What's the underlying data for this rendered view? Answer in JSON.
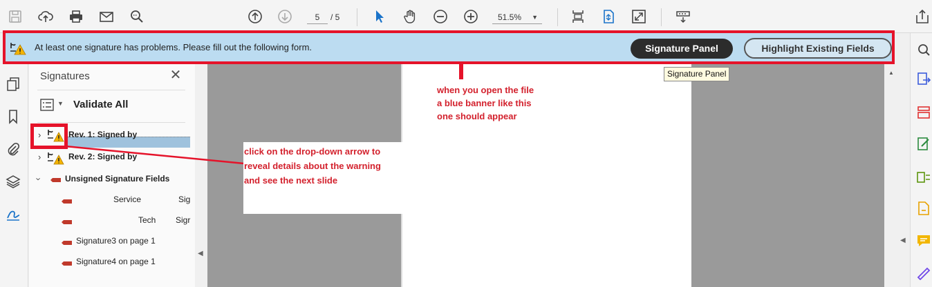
{
  "toolbar": {
    "page_current": "5",
    "page_total": "/ 5",
    "zoom": "51.5%",
    "icons": [
      "save-icon",
      "cloud-upload-icon",
      "print-icon",
      "email-icon",
      "search-icon",
      "arrow-up-icon",
      "arrow-down-icon",
      "select-cursor-icon",
      "hand-icon",
      "zoom-out-icon",
      "zoom-in-icon",
      "fit-page-icon",
      "scroll-mode-icon",
      "fullscreen-icon",
      "stamp-icon",
      "share-icon"
    ]
  },
  "banner": {
    "message": "At least one signature has problems.  Please fill out the following form.",
    "signature_panel_button": "Signature Panel",
    "highlight_button": "Highlight Existing Fields",
    "tooltip": "Signature Panel"
  },
  "signatures_panel": {
    "title": "Signatures",
    "validate_all": "Validate All",
    "rows": [
      {
        "label": "Rev. 1: Signed by"
      },
      {
        "label": "Rev. 2: Signed by"
      },
      {
        "label": "Unsigned Signature Fields"
      }
    ],
    "fields": [
      {
        "left": "Service",
        "right": "Sig"
      },
      {
        "left": "Tech",
        "right": "Sigr"
      },
      {
        "label": "Signature3 on page 1"
      },
      {
        "label": "Signature4 on page 1"
      }
    ]
  },
  "annotations": {
    "banner_note": "when you open the file\na blue banner like this\none should appear",
    "dropdown_note": "click on the drop-down arrow to\nreveal details about the warning\nand see the next slide"
  },
  "colors": {
    "annotation_red": "#e5132a",
    "banner_blue": "#bcdcf1",
    "annotation_text": "#d3212d"
  }
}
